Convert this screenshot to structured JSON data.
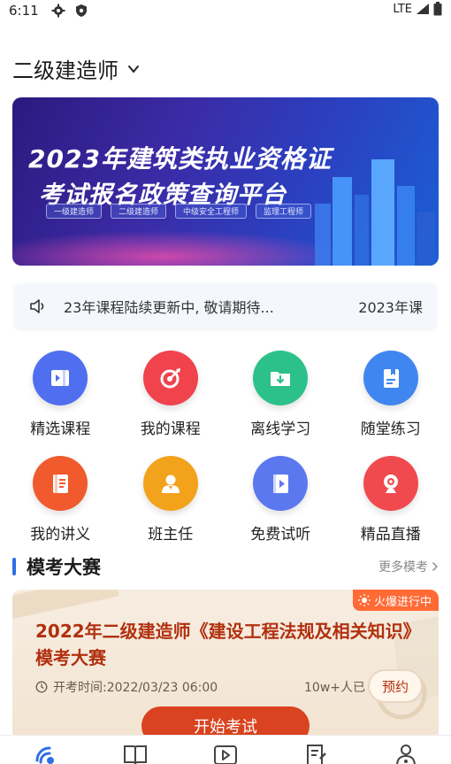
{
  "status_bar": {
    "time": "6:11",
    "network": "LTE",
    "icons": [
      "gear-icon",
      "shield-icon",
      "signal-icon",
      "battery-icon"
    ]
  },
  "header": {
    "title": "二级建造师"
  },
  "banner": {
    "title_line1": "2023年建筑类执业资格证",
    "title_line2": "考试报名政策查询平台",
    "tags": [
      "一级建造师",
      "二级建造师",
      "中级安全工程师",
      "监理工程师"
    ]
  },
  "notice": {
    "text": "23年课程陆续更新中, 敬请期待...",
    "text_right": "2023年课"
  },
  "grid": {
    "items": [
      {
        "label": "精选课程",
        "icon": "video-book-icon",
        "color": "#4f6ff0"
      },
      {
        "label": "我的课程",
        "icon": "target-icon",
        "color": "#f0434c"
      },
      {
        "label": "离线学习",
        "icon": "download-folder-icon",
        "color": "#2cc18a"
      },
      {
        "label": "随堂练习",
        "icon": "notebook-icon",
        "color": "#3f86f0"
      },
      {
        "label": "我的讲义",
        "icon": "handout-icon",
        "color": "#f05a2c"
      },
      {
        "label": "班主任",
        "icon": "teacher-icon",
        "color": "#f3a21c"
      },
      {
        "label": "免费试听",
        "icon": "play-book-icon",
        "color": "#5b78ef"
      },
      {
        "label": "精品直播",
        "icon": "webcam-icon",
        "color": "#f04a4f"
      }
    ]
  },
  "section": {
    "title": "模考大赛",
    "more": "更多模考"
  },
  "contest": {
    "badge": "火爆进行中",
    "title": "2022年二级建造师《建设工程法规及相关知识》模考大赛",
    "time_label": "开考时间:2022/03/23 06:00",
    "count": "10w+人已",
    "reserve": "预约",
    "start": "开始考试"
  },
  "colors": {
    "accent": "#2f6fe6",
    "contest_red": "#b1300f",
    "start_button": "#d9431f",
    "badge": "#ff6a35"
  },
  "bottom_nav": {
    "icons": [
      "home-satellite-icon",
      "book-icon",
      "play-icon",
      "exam-icon",
      "profile-icon"
    ]
  }
}
